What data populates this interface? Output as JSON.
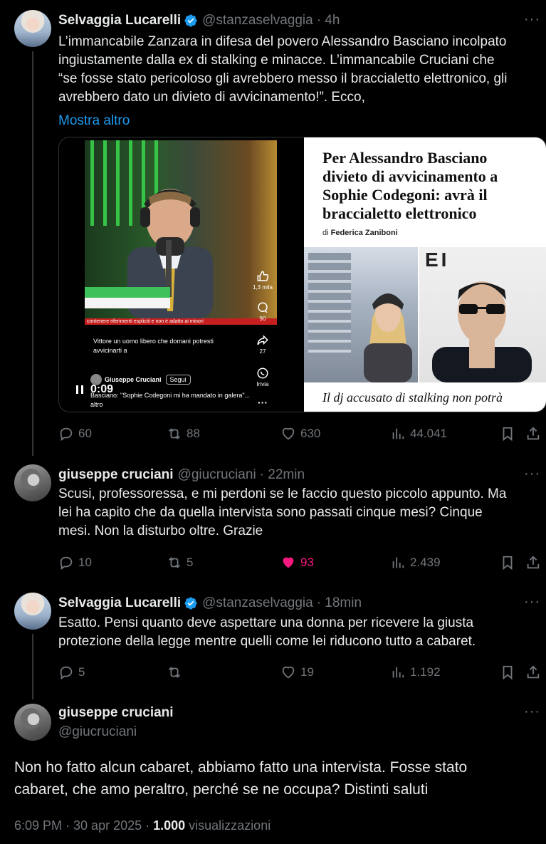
{
  "tweets": [
    {
      "name": "Selvaggia Lucarelli",
      "handle": "@stanzaselvaggia",
      "time": "· 4h",
      "more": "···",
      "text_lines": [
        "L’immancabile Zanzara in difesa del povero Alessandro Basciano incolpato",
        "ingiustamente dalla ex di stalking e minacce. L’immancabile Cruciani che",
        "“se fosse stato pericoloso gli avrebbero messo il braccialetto elettronico, gli",
        "avrebbero dato un divieto di avvicinamento!”. Ecco,"
      ],
      "show_more": "Mostra altro",
      "replies": "60",
      "retweets": "88",
      "likes": "630",
      "views": "44.041"
    },
    {
      "name": "giuseppe cruciani",
      "handle": "@giucruciani",
      "time": "· 22min",
      "more": "···",
      "text_lines": [
        "Scusi, professoressa, e mi perdoni se le faccio questo piccolo appunto. Ma",
        "lei ha capito che da quella intervista sono passati cinque mesi? Cinque",
        "mesi. Non la disturbo oltre. Grazie"
      ],
      "replies": "10",
      "retweets": "5",
      "likes": "93",
      "views": "2.439"
    },
    {
      "name": "Selvaggia Lucarelli",
      "handle": "@stanzaselvaggia",
      "time": "· 18min",
      "more": "···",
      "text_lines": [
        "Esatto. Pensi quanto deve aspettare una donna per ricevere la giusta",
        "protezione della legge mentre quelli come lei riducono tutto a cabaret."
      ],
      "replies": "5",
      "retweets": "",
      "likes": "19",
      "views": "1.192"
    },
    {
      "name": "giuseppe cruciani",
      "handle": "@giucruciani",
      "more": "···",
      "text_lines": [
        "Non ho fatto alcun cabaret, abbiamo fatto una intervista. Fosse stato",
        "cabaret, che amo peraltro, perché se ne occupa? Distinti saluti"
      ],
      "timestamp": "6:09 PM · 30 apr 2025 · ",
      "view_count": "1.000",
      "views_label": " visualizzazioni"
    }
  ],
  "video": {
    "warning": "contenere riferimenti espliciti e non è adatto ai minori",
    "likes": "1,3 mila",
    "comments": "90",
    "shares": "27",
    "send_label": "Invia",
    "more": "···",
    "caption": "Vittore un uomo libero che domani potresti avvicinarti a",
    "author": "Giuseppe Cruciani",
    "follow": "Segui",
    "description": "Basciano: \"Sophie Codegoni mi ha mandato in galera\"... altro",
    "time": "0:09"
  },
  "article": {
    "title_lines": [
      "Per Alessandro Basciano",
      "divieto di avvicinamento a",
      "Sophie Codegoni: avrà il",
      "braccialetto elettronico"
    ],
    "author_prefix": "di ",
    "author": "Federica Zaniboni",
    "photo_text": "EI",
    "subtitle": "Il dj accusato di stalking non potrà"
  },
  "colors": {
    "background": "#000000",
    "text": "#e7e9ea",
    "secondary": "#71767b",
    "link": "#1d9bf0",
    "like": "#f91880",
    "verified": "#1d9bf0"
  }
}
